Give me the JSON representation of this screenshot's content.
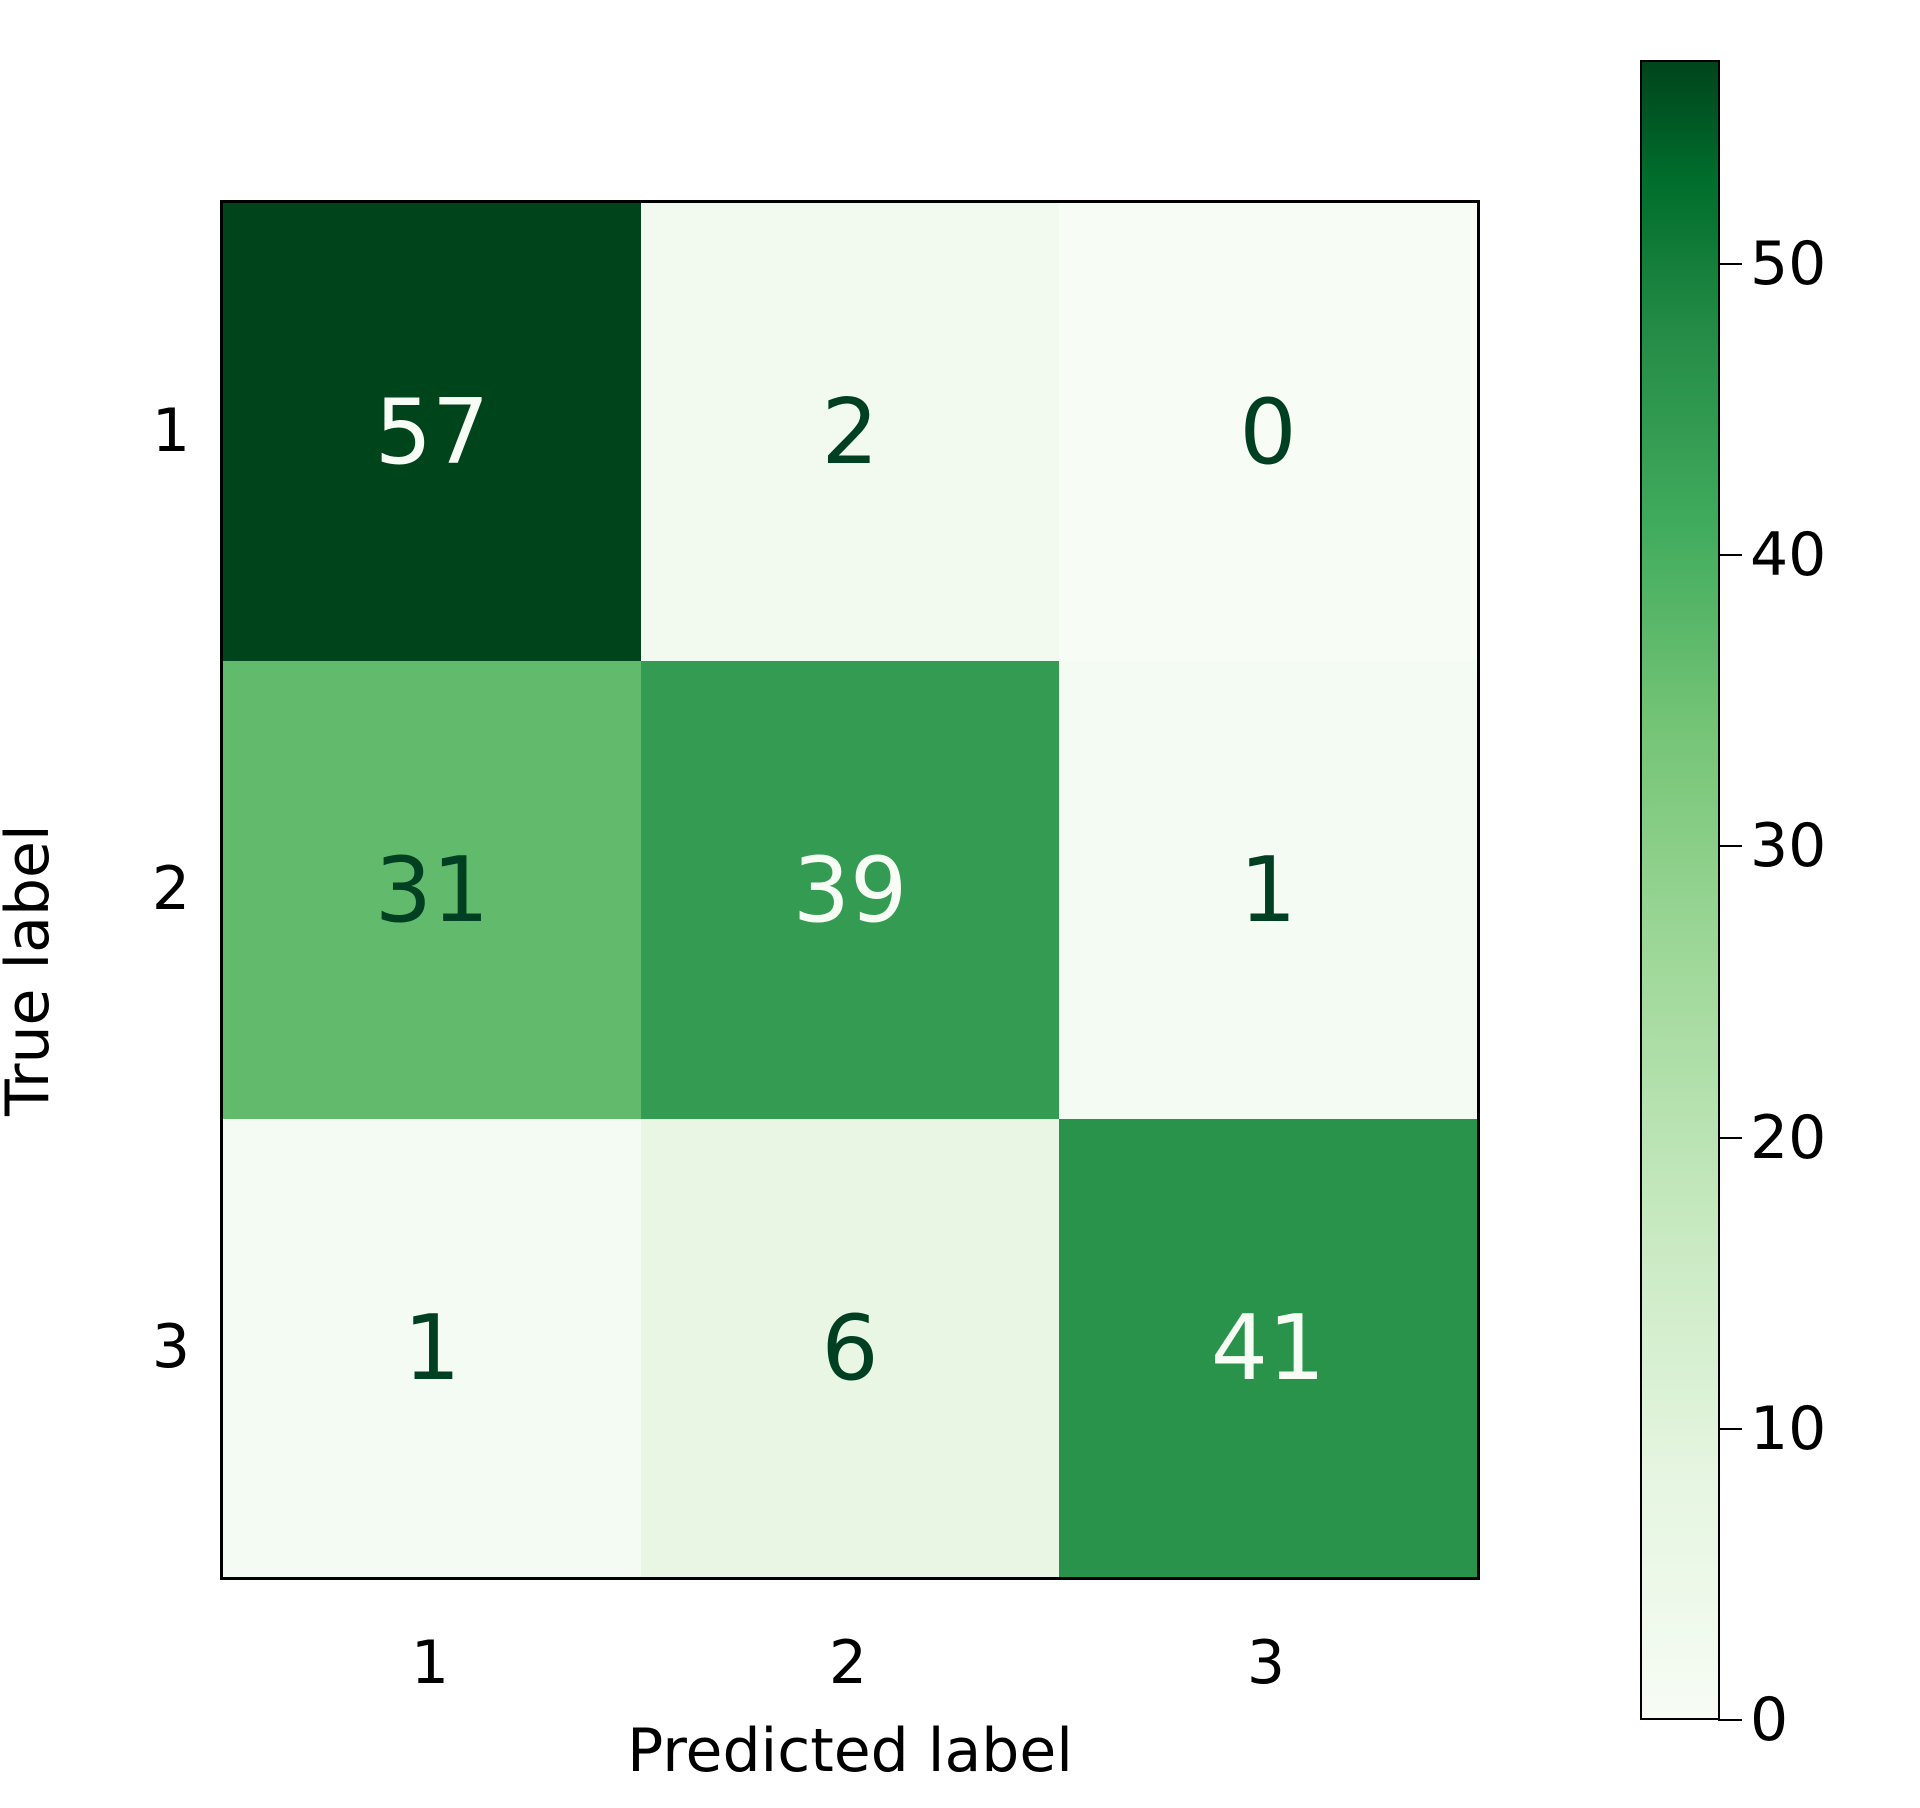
{
  "chart_data": {
    "type": "heatmap",
    "title": "",
    "xlabel": "Predicted label",
    "ylabel": "True label",
    "row_categories": [
      "1",
      "2",
      "3"
    ],
    "col_categories": [
      "1",
      "2",
      "3"
    ],
    "matrix": [
      [
        57,
        2,
        0
      ],
      [
        31,
        39,
        1
      ],
      [
        1,
        6,
        41
      ]
    ],
    "colorbar": {
      "min": 0,
      "max": 57,
      "ticks": [
        0,
        10,
        20,
        30,
        40,
        50
      ]
    },
    "colormap_name": "Greens"
  }
}
